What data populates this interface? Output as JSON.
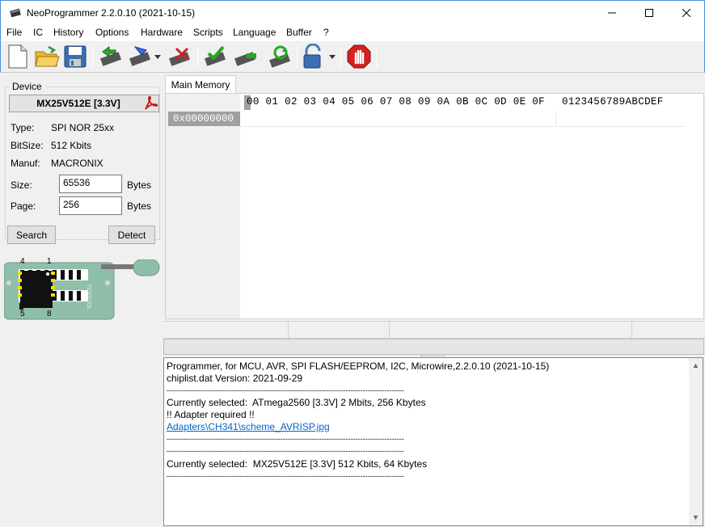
{
  "window": {
    "title": "NeoProgrammer 2.2.0.10 (2021-10-15)",
    "icon": "chip-icon"
  },
  "menu": [
    "File",
    "IC",
    "History",
    "Options",
    "Hardware",
    "Scripts",
    "Language",
    "Buffer",
    "?"
  ],
  "device": {
    "group_label": "Device",
    "chip_name": "MX25V512E [3.3V]",
    "type_label": "Type:",
    "type_value": "SPI NOR 25xx",
    "bitsize_label": "BitSize:",
    "bitsize_value": "512 Kbits",
    "manuf_label": "Manuf:",
    "manuf_value": "MACRONIX",
    "size_label": "Size:",
    "size_value": "65536",
    "size_unit": "Bytes",
    "page_label": "Page:",
    "page_value": "256",
    "page_unit": "Bytes",
    "search_button": "Search",
    "detect_button": "Detect"
  },
  "socket": {
    "pin_top_left": "4",
    "pin_top_right": "1",
    "pin_bottom_left": "5",
    "pin_bottom_right": "8",
    "brand": "TEXTOOL"
  },
  "tabs": [
    "Main Memory"
  ],
  "hex": {
    "header_bytes": "00 01 02 03 04 05 06 07 08 09 0A 0B 0C 0D 0E 0F",
    "header_ascii": "0123456789ABCDEF",
    "first_address": "0x00000000"
  },
  "log": {
    "lines": [
      {
        "text": "Programmer, for MCU, AVR, SPI FLASH/EEPROM, I2C, Microwire,2.2.0.10 (2021-10-15)",
        "link": false
      },
      {
        "text": "chiplist.dat Version: 2021-09-29",
        "link": false
      },
      {
        "text": "--------------------------------------------------------------------------------------------------",
        "link": false
      },
      {
        "text": "Currently selected:  ATmega2560 [3.3V] 2 Mbits, 256 Kbytes",
        "link": false
      },
      {
        "text": "!! Adapter required !!",
        "link": false
      },
      {
        "text": "Adapters\\CH341\\scheme_AVRISP.jpg",
        "link": true
      },
      {
        "text": "--------------------------------------------------------------------------------------------------",
        "link": false
      },
      {
        "text": "--------------------------------------------------------------------------------------------------",
        "link": false
      },
      {
        "text": "Currently selected:  MX25V512E [3.3V] 512 Kbits, 64 Kbytes",
        "link": false
      },
      {
        "text": "--------------------------------------------------------------------------------------------------",
        "link": false
      }
    ]
  }
}
